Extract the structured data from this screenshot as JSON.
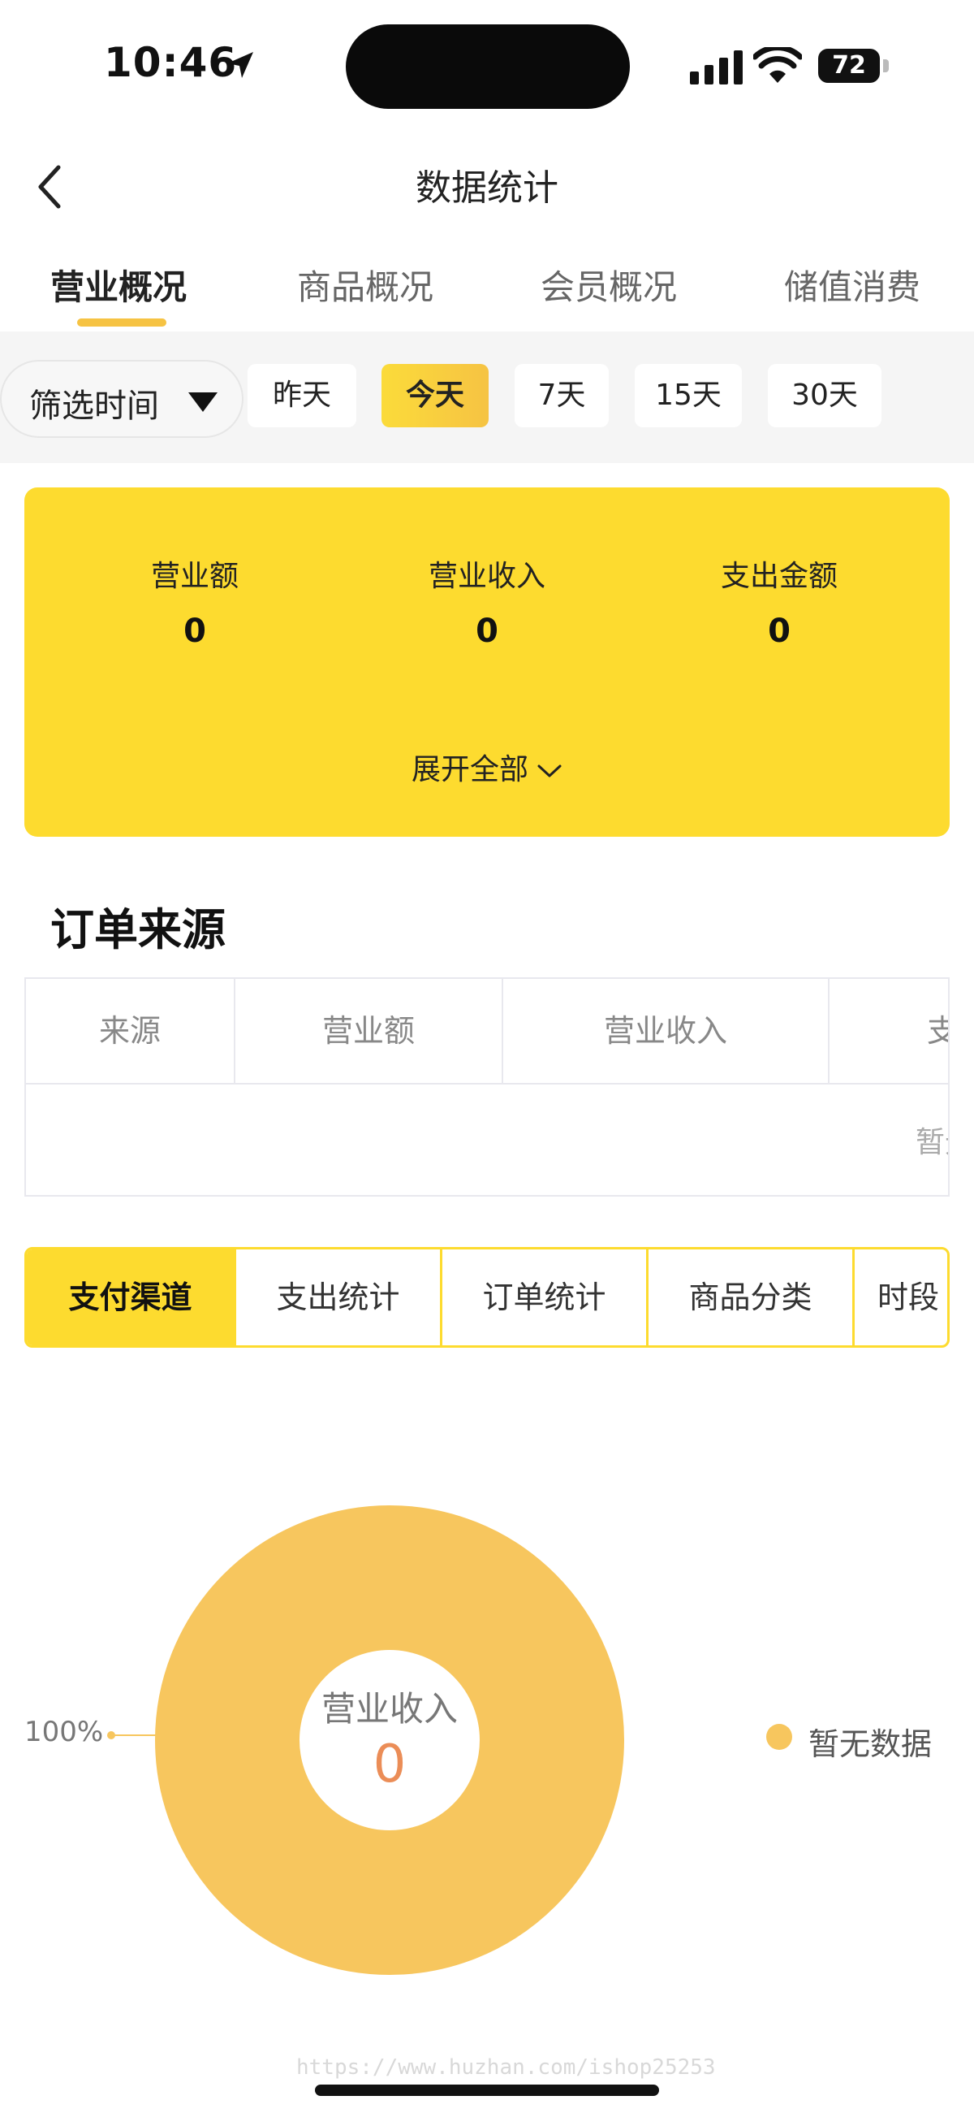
{
  "status_bar": {
    "time": "10:46",
    "battery": "72"
  },
  "nav": {
    "title": "数据统计"
  },
  "tabs": [
    {
      "label": "营业概况",
      "active": true
    },
    {
      "label": "商品概况"
    },
    {
      "label": "会员概况"
    },
    {
      "label": "储值消费"
    }
  ],
  "filter": {
    "label": "筛选时间",
    "options": [
      {
        "label": "昨天"
      },
      {
        "label": "今天",
        "active": true
      },
      {
        "label": "7天"
      },
      {
        "label": "15天"
      },
      {
        "label": "30天"
      }
    ]
  },
  "summary": {
    "metrics": [
      {
        "label": "营业额",
        "value": "0"
      },
      {
        "label": "营业收入",
        "value": "0"
      },
      {
        "label": "支出金额",
        "value": "0"
      }
    ],
    "expand_label": "展开全部"
  },
  "order_source": {
    "title": "订单来源",
    "columns": [
      "来源",
      "营业额",
      "营业收入",
      "支"
    ],
    "empty_text": "暂无数据"
  },
  "channel_tabs": [
    {
      "label": "支付渠道",
      "active": true
    },
    {
      "label": "支出统计"
    },
    {
      "label": "订单统计"
    },
    {
      "label": "商品分类"
    },
    {
      "label": "时段"
    }
  ],
  "donut": {
    "center_label": "营业收入",
    "center_value": "0",
    "percent_label": "100%",
    "legend_label": "暂无数据",
    "color": "#F7C65E"
  },
  "watermark": "https://www.huzhan.com/ishop25253",
  "colors": {
    "accent": "#FDDB2F",
    "donut": "#F7C65E",
    "center_value": "#EB8D57"
  }
}
